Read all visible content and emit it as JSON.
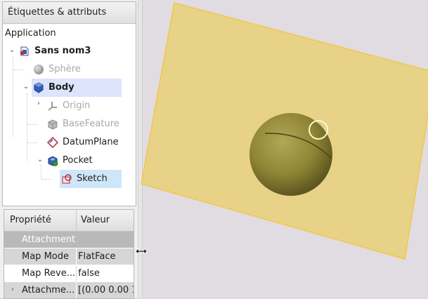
{
  "tree": {
    "title": "Étiquettes & attributs",
    "section": "Application",
    "items": [
      {
        "label": "Sans nom3",
        "icon": "document-icon"
      },
      {
        "label": "Sphère",
        "icon": "sphere-icon"
      },
      {
        "label": "Body",
        "icon": "body-icon"
      },
      {
        "label": "Origin",
        "icon": "origin-icon"
      },
      {
        "label": "BaseFeature",
        "icon": "base-feature-icon"
      },
      {
        "label": "DatumPlane",
        "icon": "datum-plane-icon"
      },
      {
        "label": "Pocket",
        "icon": "pocket-icon"
      },
      {
        "label": "Sketch",
        "icon": "sketch-icon"
      }
    ]
  },
  "properties": {
    "headers": [
      "Propriété",
      "Valeur"
    ],
    "group": "Attachment",
    "rows": [
      {
        "name": "Map Mode",
        "value": "FlatFace"
      },
      {
        "name": "Map Reve...",
        "value": "false"
      },
      {
        "name": "Attachme...",
        "value": "[(0.00 0.00 1."
      }
    ]
  },
  "colors": {
    "viewport_bg": "#e1dbe2",
    "plane_fill": "#e8d17f",
    "sphere": "#8f8535",
    "selection": "#dde4fb",
    "highlight": "#cfe6f8"
  }
}
